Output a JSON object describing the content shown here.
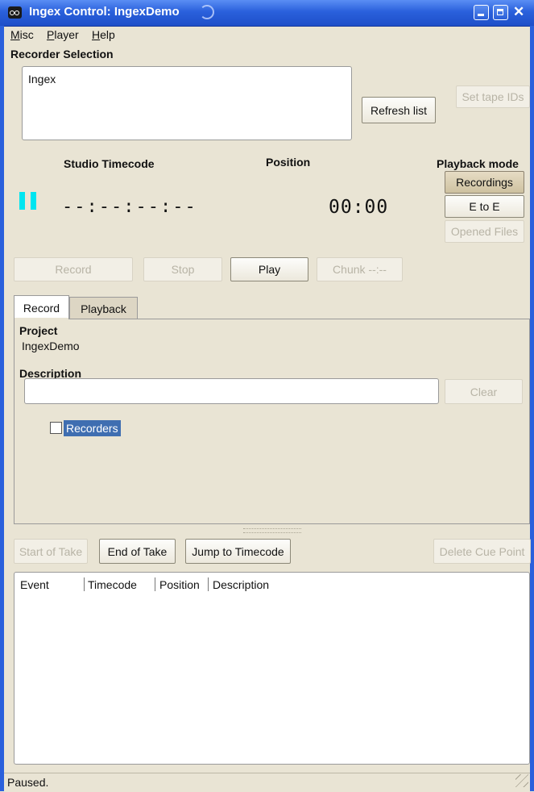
{
  "window": {
    "title": "Ingex Control: IngexDemo"
  },
  "menu": {
    "items": [
      {
        "pre": "",
        "u": "M",
        "post": "isc"
      },
      {
        "pre": "",
        "u": "P",
        "post": "layer"
      },
      {
        "pre": "",
        "u": "H",
        "post": "elp"
      }
    ]
  },
  "recorder_selection": {
    "heading": "Recorder Selection",
    "list": [
      "Ingex"
    ],
    "refresh_label": "Refresh list",
    "set_tape_ids_label": "Set tape IDs"
  },
  "timecode": {
    "studio_label": "Studio Timecode",
    "studio_value": "--:--:--:--",
    "position_label": "Position",
    "position_value": "00:00",
    "state_icon": "pause-icon"
  },
  "playback_mode": {
    "heading": "Playback mode",
    "options": [
      "Recordings",
      "E to E",
      "Opened Files"
    ],
    "selected": "Recordings"
  },
  "transport": {
    "record_label": "Record",
    "stop_label": "Stop",
    "play_label": "Play",
    "chunk_label": "Chunk --:--"
  },
  "tabs": {
    "record": "Record",
    "playback": "Playback",
    "active": "Record"
  },
  "record_tab": {
    "project_label": "Project",
    "project_value": "IngexDemo",
    "description_label": "Description",
    "description_value": "",
    "clear_label": "Clear",
    "tree_item": "Recorders"
  },
  "cue_buttons": {
    "start_of_take": "Start of Take",
    "end_of_take": "End of Take",
    "jump_to_timecode": "Jump to Timecode",
    "delete_cue_point": "Delete Cue Point"
  },
  "events_table": {
    "columns": [
      "Event",
      "Timecode",
      "Position",
      "Description"
    ],
    "rows": []
  },
  "status": {
    "text": "Paused."
  },
  "colors": {
    "titlebar": "#2a60dc",
    "pause_icon": "#00e5f0",
    "selection": "#3f6eb1"
  }
}
